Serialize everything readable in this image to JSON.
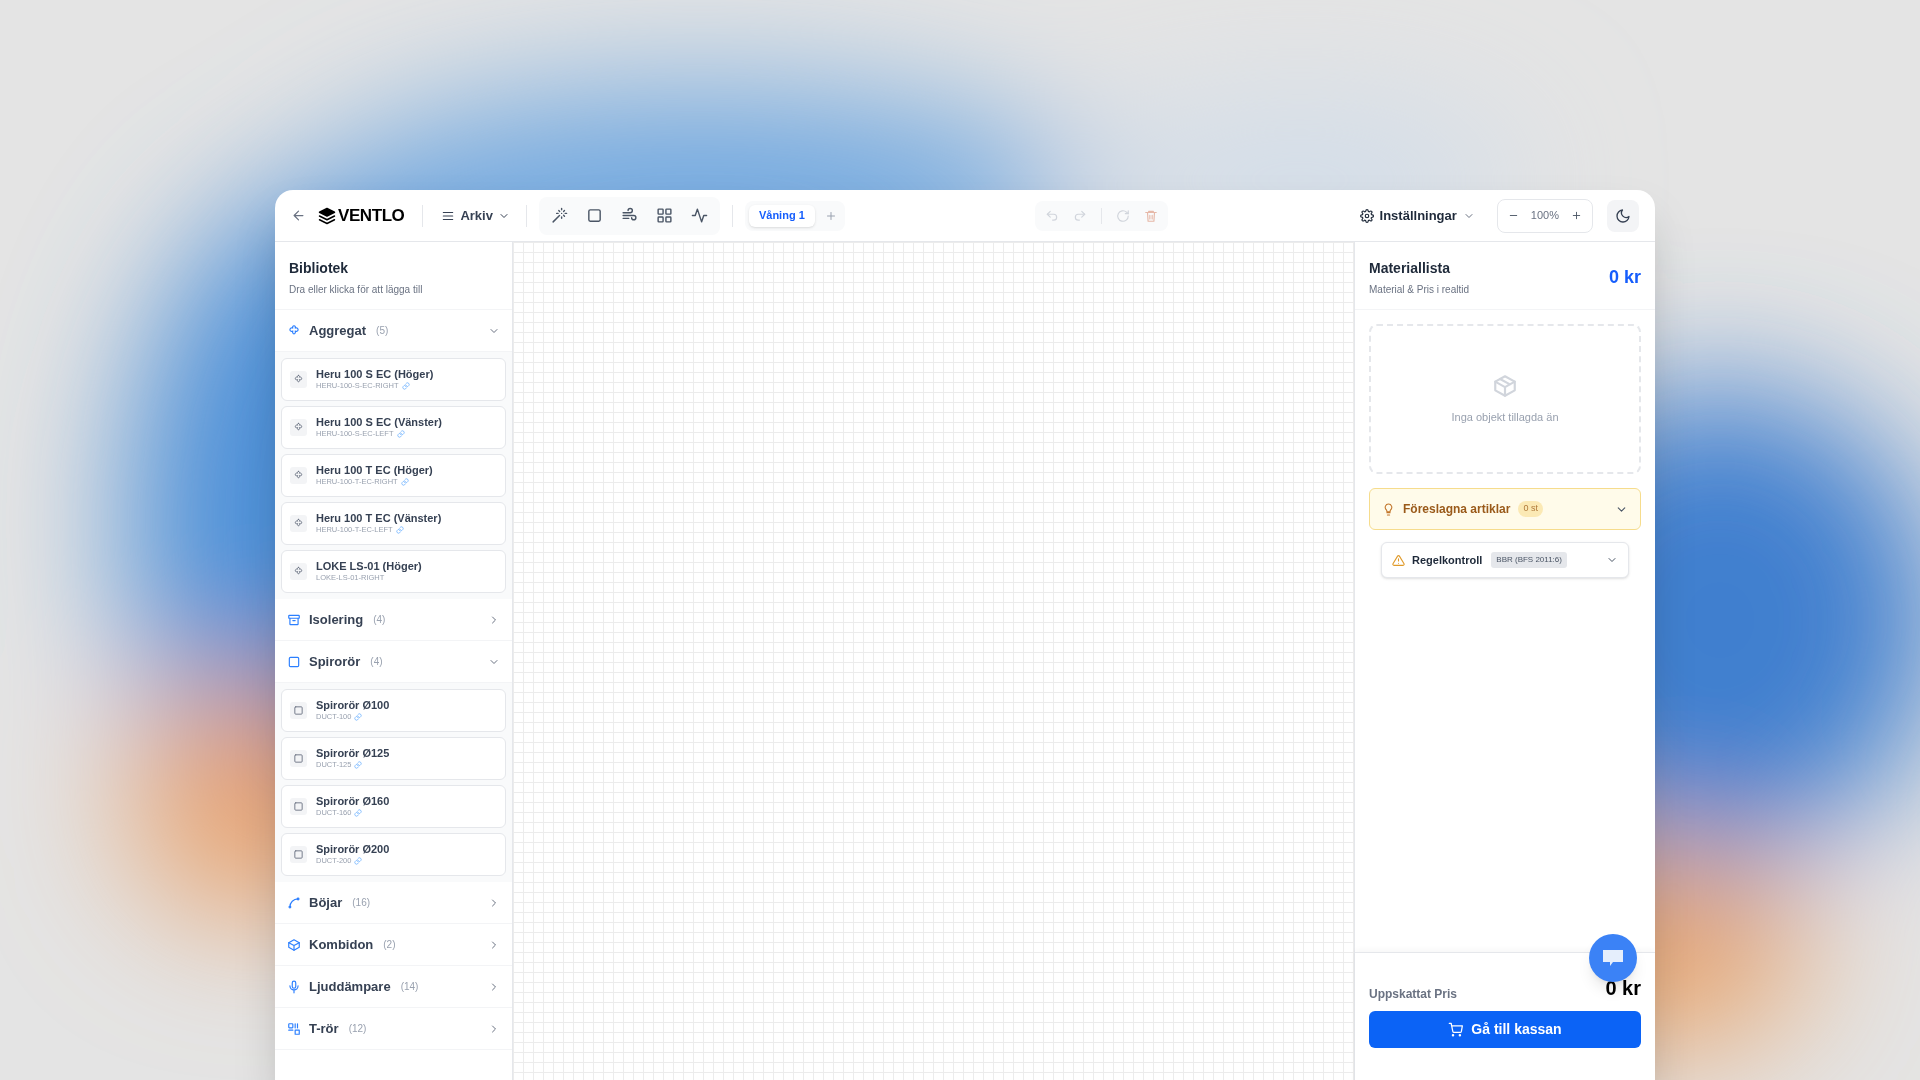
{
  "header": {
    "logo_text": "VENTLO",
    "menu": {
      "label": "Arkiv"
    },
    "floors": [
      {
        "label": "Våning 1",
        "selected": true
      }
    ],
    "settings": {
      "label": "Inställningar"
    },
    "zoom": {
      "value": "100%"
    }
  },
  "library": {
    "title": "Bibliotek",
    "subtitle": "Dra eller klicka för att lägga till",
    "categories": [
      {
        "kind": "unit",
        "label": "Aggregat",
        "count": "(5)",
        "expanded": true,
        "items": [
          {
            "name": "Heru 100 S EC (Höger)",
            "code": "HERU-100-S-EC-RIGHT",
            "linked": true
          },
          {
            "name": "Heru 100 S EC (Vänster)",
            "code": "HERU-100-S-EC-LEFT",
            "linked": true
          },
          {
            "name": "Heru 100 T EC (Höger)",
            "code": "HERU-100-T-EC-RIGHT",
            "linked": true
          },
          {
            "name": "Heru 100 T EC (Vänster)",
            "code": "HERU-100-T-EC-LEFT",
            "linked": true
          },
          {
            "name": "LOKE LS-01 (Höger)",
            "code": "LOKE-LS-01-RIGHT",
            "linked": false
          }
        ]
      },
      {
        "kind": "insulation",
        "label": "Isolering",
        "count": "(4)",
        "expanded": false
      },
      {
        "kind": "duct",
        "label": "Spirorör",
        "count": "(4)",
        "expanded": true,
        "items": [
          {
            "name": "Spirorör Ø100",
            "code": "DUCT-100",
            "linked": true
          },
          {
            "name": "Spirorör Ø125",
            "code": "DUCT-125",
            "linked": true
          },
          {
            "name": "Spirorör Ø160",
            "code": "DUCT-160",
            "linked": true
          },
          {
            "name": "Spirorör Ø200",
            "code": "DUCT-200",
            "linked": true
          }
        ]
      },
      {
        "kind": "bend",
        "label": "Böjar",
        "count": "(16)",
        "expanded": false
      },
      {
        "kind": "cube",
        "label": "Kombidon",
        "count": "(2)",
        "expanded": false
      },
      {
        "kind": "silencer",
        "label": "Ljuddämpare",
        "count": "(14)",
        "expanded": false
      },
      {
        "kind": "tee",
        "label": "T-rör",
        "count": "(12)",
        "expanded": false
      }
    ]
  },
  "materials": {
    "title": "Materiallista",
    "subtitle": "Material & Pris i realtid",
    "total": "0 kr",
    "empty_text": "Inga objekt tillagda än",
    "suggested": {
      "label": "Föreslagna artiklar",
      "badge": "0 st"
    },
    "rule_check": {
      "label": "Regelkontroll",
      "badge": "BBR (BFS 2011:6)"
    },
    "estimate_label": "Uppskattat Pris",
    "estimate": "0 kr",
    "checkout": "Gå till kassan"
  }
}
